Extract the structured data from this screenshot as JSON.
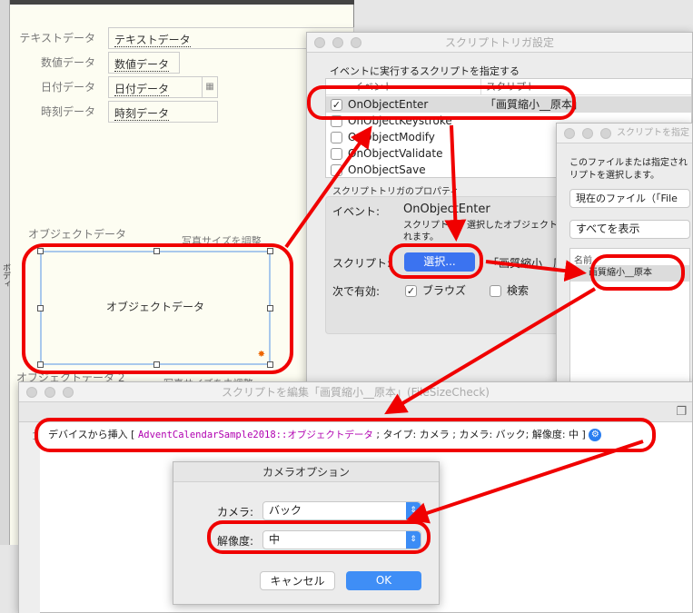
{
  "layout": {
    "fields": [
      {
        "label": "テキストデータ",
        "value": "テキストデータ"
      },
      {
        "label": "数値データ",
        "value": "数値データ"
      },
      {
        "label": "日付データ",
        "value": "日付データ"
      },
      {
        "label": "時刻データ",
        "value": "時刻データ"
      }
    ],
    "object_label": "オブジェクトデータ",
    "photo_resize": "写真サイズを調整",
    "object_field": "オブジェクトデータ",
    "object_label2": "オブジェクトデータ 2",
    "photo_resize2": "写真サイズを未調整",
    "body_tab": "ボディ"
  },
  "trigger_window": {
    "title": "スクリプトトリガ設定",
    "instruction": "イベントに実行するスクリプトを指定する",
    "columns": [
      "イベント",
      "スクリプト"
    ],
    "rows": [
      {
        "event": "OnObjectEnter",
        "script": "「画質縮小__原本」",
        "checked": true
      },
      {
        "event": "OnObjectKeystroke",
        "script": "",
        "checked": false
      },
      {
        "event": "OnObjectModify",
        "script": "",
        "checked": false
      },
      {
        "event": "OnObjectValidate",
        "script": "",
        "checked": false
      },
      {
        "event": "OnObjectSave",
        "script": "",
        "checked": false
      }
    ],
    "props_title": "スクリプトトリガのプロパティ",
    "event_label": "イベント:",
    "event_value": "OnObjectEnter",
    "event_desc1": "スクリプトは、選択したオブジェクト",
    "event_desc2": "れます。",
    "script_label": "スクリプト:",
    "select_button": "選択...",
    "script_value": "「画質縮小__原本」",
    "enabled_label": "次で有効:",
    "browse_label": "ブラウズ",
    "find_label": "検索"
  },
  "select_window": {
    "title": "スクリプトを指定",
    "desc1": "このファイルまたは指定され",
    "desc2": "リプトを選択します。",
    "file_popup": "現在のファイル（「File",
    "filter_popup": "すべてを表示",
    "column": "名前",
    "item": "画質縮小__原本"
  },
  "edit_window": {
    "title": "スクリプトを編集「画質縮小__原本」(FileSizeCheck)",
    "line_no": "1",
    "step_prefix": "デバイスから挿入 [ ",
    "step_field": "AdventCalendarSample2018::オブジェクトデータ",
    "step_suffix": " ; タイプ: カメラ ; カメラ: バック; 解像度: 中 ]"
  },
  "camera_dialog": {
    "title": "カメラオプション",
    "camera_label": "カメラ:",
    "camera_value": "バック",
    "resolution_label": "解像度:",
    "resolution_value": "中",
    "cancel": "キャンセル",
    "ok": "OK"
  },
  "colors": {
    "annotation": "#f00000",
    "accent": "#3b8cf5",
    "field_purple": "#b000b0"
  }
}
